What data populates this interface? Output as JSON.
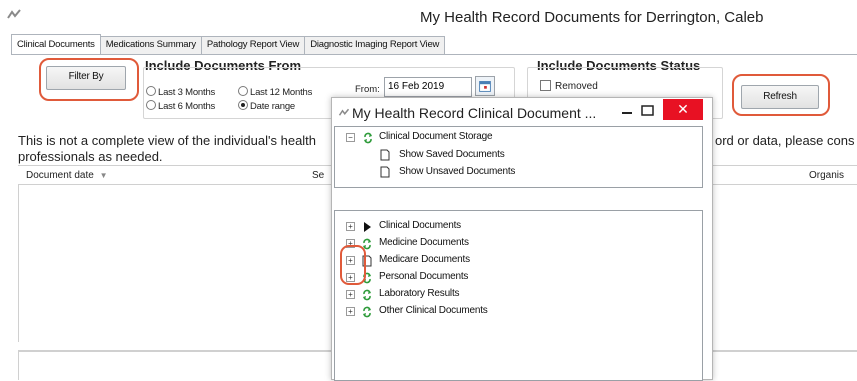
{
  "window": {
    "title": "My Health Record Documents for Derrington, Caleb"
  },
  "tabs": [
    {
      "label": "Clinical Documents",
      "active": true
    },
    {
      "label": "Medications Summary",
      "active": false
    },
    {
      "label": "Pathology Report View",
      "active": false
    },
    {
      "label": "Diagnostic Imaging Report View",
      "active": false
    }
  ],
  "filter": {
    "button_label": "Filter By",
    "include_from_title": "Include Documents From",
    "options": [
      "Last 3 Months",
      "Last 12 Months",
      "Last 6 Months",
      "Date range"
    ],
    "selected": "Date range",
    "from_label": "From:",
    "from_value": "16 Feb 2019"
  },
  "status": {
    "title": "Include Documents Status",
    "removed_label": "Removed",
    "removed_checked": false
  },
  "refresh_label": "Refresh",
  "notice": {
    "line1": "This is not a complete view of the individual's health",
    "line1_tail": "ord or data, please cons",
    "line2": "professionals as needed."
  },
  "grid": {
    "columns": [
      "Document date",
      "Se",
      "Organis"
    ]
  },
  "dialog": {
    "title": "My Health Record Clinical Document ...",
    "storage": {
      "root": "Clinical Document Storage",
      "children": [
        "Show Saved Documents",
        "Show Unsaved Documents"
      ]
    },
    "categories": [
      {
        "label": "Clinical Documents",
        "icon": "triangle-play-icon"
      },
      {
        "label": "Medicine Documents",
        "icon": "refresh-arrows-icon"
      },
      {
        "label": "Medicare Documents",
        "icon": "document-icon"
      },
      {
        "label": "Personal Documents",
        "icon": "refresh-arrows-icon"
      },
      {
        "label": "Laboratory Results",
        "icon": "refresh-arrows-icon"
      },
      {
        "label": "Other Clinical Documents",
        "icon": "refresh-arrows-icon"
      }
    ]
  },
  "colors": {
    "highlight": "#e05a3a",
    "close_button": "#e81123",
    "sync_green": "#2e9b3a"
  }
}
